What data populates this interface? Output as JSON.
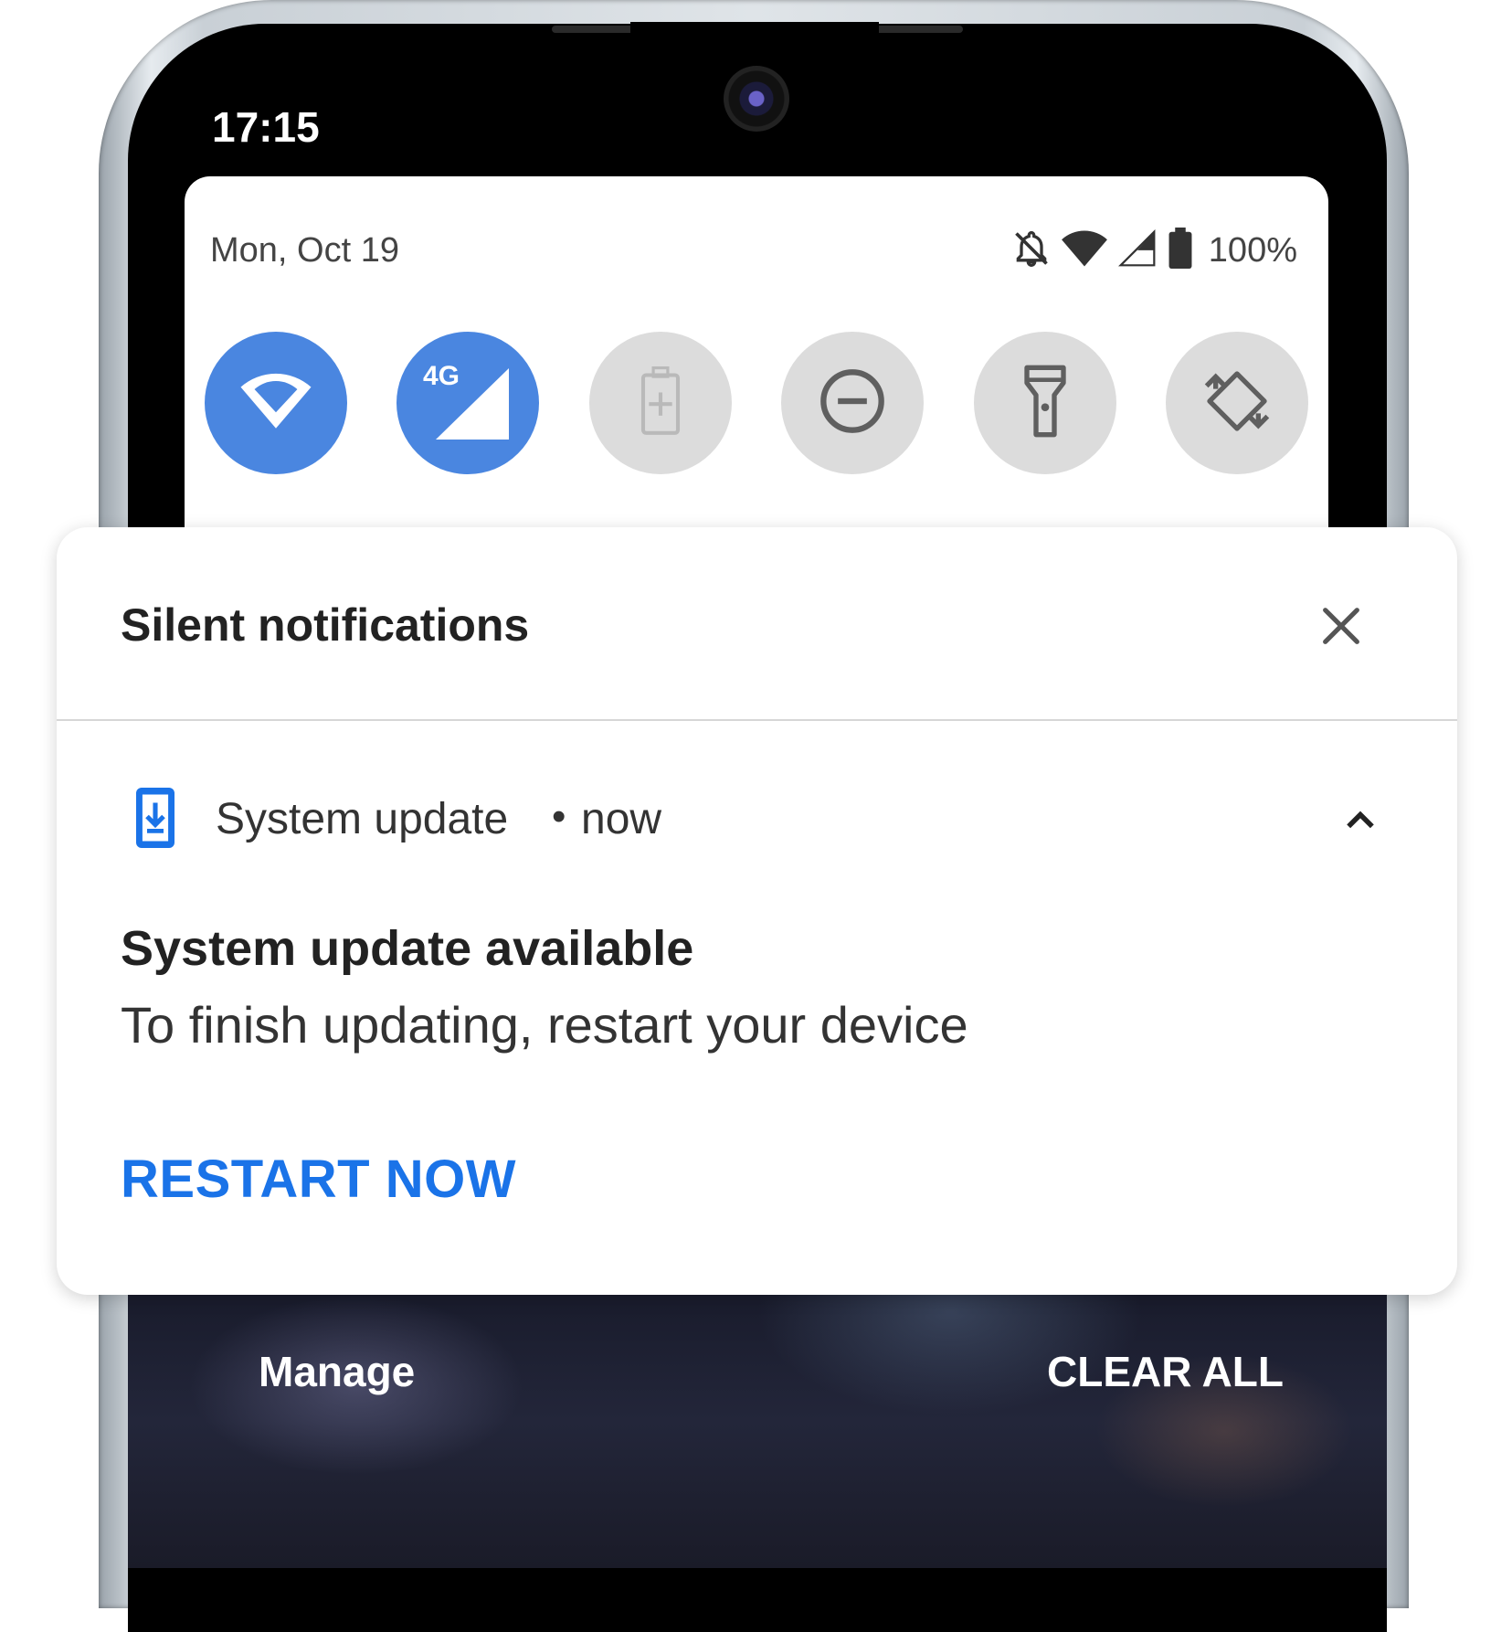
{
  "status_bar": {
    "time": "17:15"
  },
  "quick_settings": {
    "date": "Mon, Oct 19",
    "battery_percent": "100%",
    "status_icons": [
      "bell-off-icon",
      "wifi-icon",
      "cell-signal-icon",
      "battery-icon"
    ],
    "network_tile_label": "4G",
    "tiles": [
      {
        "name": "wifi",
        "icon": "wifi-icon",
        "active": true
      },
      {
        "name": "mobile-data",
        "icon": "cell-signal-icon",
        "active": true
      },
      {
        "name": "battery-saver",
        "icon": "battery-saver-icon",
        "active": false
      },
      {
        "name": "do-not-disturb",
        "icon": "do-not-disturb-icon",
        "active": false
      },
      {
        "name": "flashlight",
        "icon": "flashlight-icon",
        "active": false
      },
      {
        "name": "auto-rotate",
        "icon": "auto-rotate-icon",
        "active": false
      }
    ]
  },
  "notification_section": {
    "title": "Silent notifications",
    "notification": {
      "app_name": "System update",
      "separator": "•",
      "time": "now",
      "title": "System update available",
      "text": "To finish updating, restart your device",
      "action": "RESTART NOW"
    }
  },
  "footer": {
    "manage": "Manage",
    "clear_all": "CLEAR ALL"
  },
  "colors": {
    "accent": "#1a73e8",
    "tile_on": "#4a86e0",
    "tile_off": "#dcdcdc"
  }
}
